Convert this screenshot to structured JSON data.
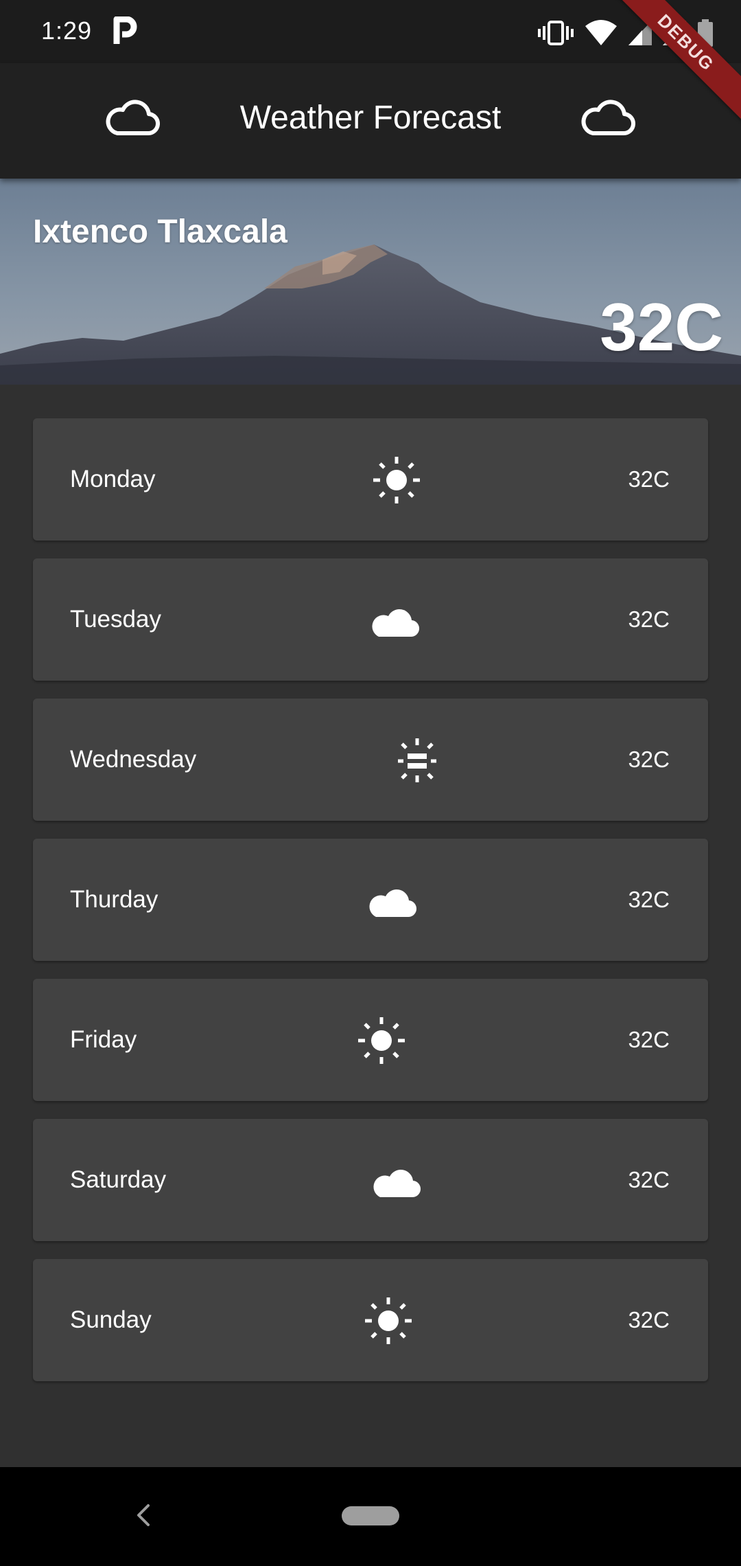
{
  "status_bar": {
    "time": "1:29",
    "icons": [
      "parking-notification-icon",
      "vibrate-icon",
      "wifi-icon",
      "signal-icon",
      "signal-icon",
      "battery-icon"
    ]
  },
  "debug_banner": {
    "label": "DEBUG"
  },
  "app_bar": {
    "title": "Weather Forecast",
    "left_icon": "cloud-outline-icon",
    "right_icon": "cloud-outline-icon"
  },
  "hero": {
    "city": "Ixtenco Tlaxcala",
    "temperature": "32C"
  },
  "days": [
    {
      "name": "Monday",
      "icon": "sun-icon",
      "temperature": "32C"
    },
    {
      "name": "Tuesday",
      "icon": "cloud-icon",
      "temperature": "32C"
    },
    {
      "name": "Wednesday",
      "icon": "partly-sun-icon",
      "temperature": "32C"
    },
    {
      "name": "Thurday",
      "icon": "cloud-icon",
      "temperature": "32C"
    },
    {
      "name": "Friday",
      "icon": "sun-icon",
      "temperature": "32C"
    },
    {
      "name": "Saturday",
      "icon": "cloud-icon",
      "temperature": "32C"
    },
    {
      "name": "Sunday",
      "icon": "sun-icon",
      "temperature": "32C"
    }
  ],
  "colors": {
    "background": "#303030",
    "app_bar": "#212121",
    "card": "#424242",
    "debug_banner": "#8a1c1c"
  }
}
